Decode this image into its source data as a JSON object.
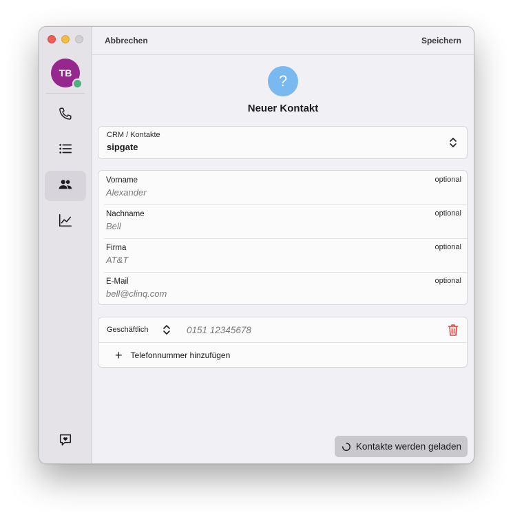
{
  "window": {
    "traffic_lights": [
      "close",
      "minimize",
      "maximize"
    ]
  },
  "sidebar": {
    "avatar": {
      "initials": "TB",
      "color": "#96278e",
      "status_color": "#4fb083"
    },
    "items": [
      {
        "name": "phone",
        "icon": "phone-icon",
        "active": false
      },
      {
        "name": "list",
        "icon": "list-icon",
        "active": false
      },
      {
        "name": "contacts",
        "icon": "contacts-icon",
        "active": true
      },
      {
        "name": "statistics",
        "icon": "chart-icon",
        "active": false
      }
    ],
    "footer_icon": "feedback-heart-icon"
  },
  "topbar": {
    "cancel_label": "Abbrechen",
    "save_label": "Speichern"
  },
  "header": {
    "avatar_glyph": "?",
    "avatar_color": "#7ab8f0",
    "title": "Neuer Kontakt"
  },
  "crm": {
    "label": "CRM / Kontakte",
    "value": "sipgate"
  },
  "fields": [
    {
      "label": "Vorname",
      "placeholder": "Alexander",
      "optional": "optional"
    },
    {
      "label": "Nachname",
      "placeholder": "Bell",
      "optional": "optional"
    },
    {
      "label": "Firma",
      "placeholder": "AT&T",
      "optional": "optional"
    },
    {
      "label": "E-Mail",
      "placeholder": "bell@clinq.com",
      "optional": "optional"
    }
  ],
  "phones": {
    "entries": [
      {
        "type": "Geschäftlich",
        "placeholder": "0151 12345678"
      }
    ],
    "add_label": "Telefonnummer hinzufügen",
    "delete_color": "#e0413b"
  },
  "toast": {
    "text": "Kontakte werden geladen"
  }
}
